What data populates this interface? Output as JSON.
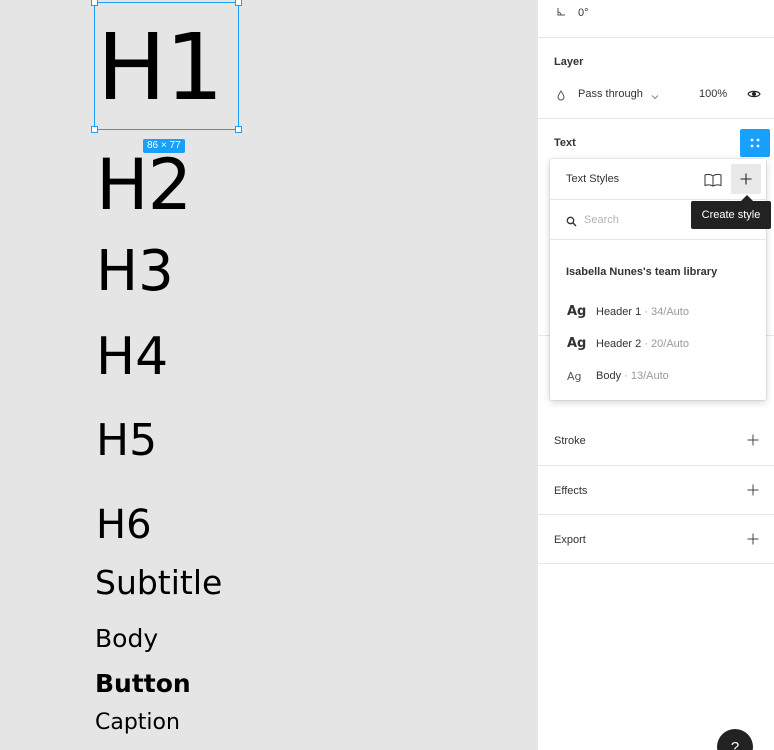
{
  "canvas": {
    "samples": {
      "h1": "H1",
      "h2": "H2",
      "h3": "H3",
      "h4": "H4",
      "h5": "H5",
      "h6": "H6",
      "subtitle": "Subtitle",
      "body": "Body",
      "button": "Button",
      "caption": "Caption"
    },
    "selection_size": "86 × 77"
  },
  "panel": {
    "rotation": {
      "icon": "angle-icon",
      "value": "0°"
    },
    "layer": {
      "title": "Layer",
      "blend_mode": "Pass through",
      "opacity": "100%"
    },
    "text": {
      "title": "Text"
    },
    "stroke": {
      "title": "Stroke"
    },
    "effects": {
      "title": "Effects"
    },
    "export": {
      "title": "Export"
    }
  },
  "text_styles_popover": {
    "title": "Text Styles",
    "search_placeholder": "Search",
    "library_name": "Isabella Nunes's team library",
    "styles": [
      {
        "preview": "Ag",
        "name": "Header 1",
        "meta": " · 34/Auto"
      },
      {
        "preview": "Ag",
        "name": "Header 2",
        "meta": " · 20/Auto"
      },
      {
        "preview": "Ag",
        "name": "Body",
        "meta": " · 13/Auto"
      }
    ]
  },
  "tooltip": {
    "text": "Create style"
  },
  "help": {
    "label": "?"
  },
  "colors": {
    "accent": "#18a0fb",
    "canvas_bg": "#e5e5e5",
    "tooltip_bg": "#222222"
  }
}
